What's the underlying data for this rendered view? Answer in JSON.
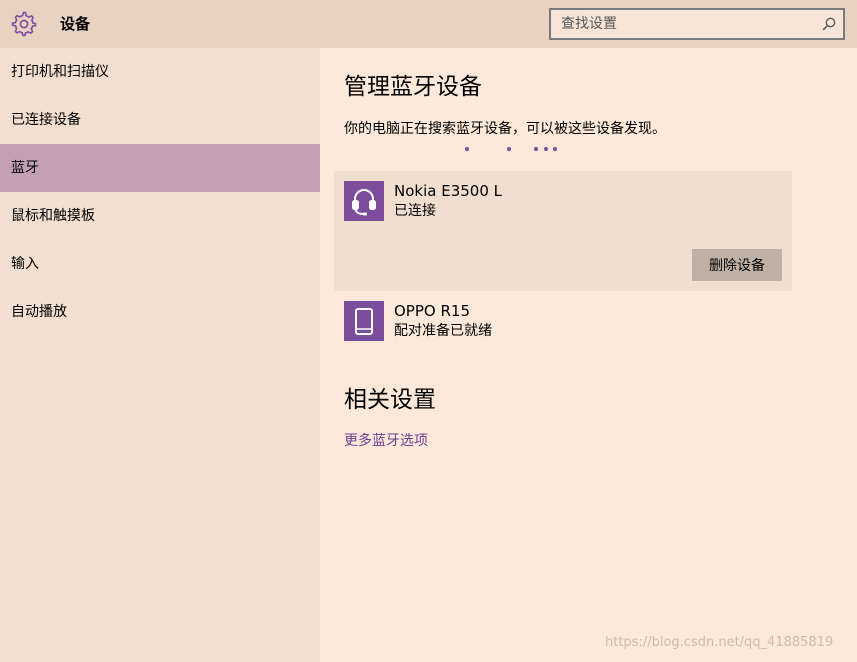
{
  "header": {
    "title": "设备",
    "search_placeholder": "查找设置",
    "icon": "gear-icon"
  },
  "sidebar": {
    "items": [
      {
        "label": "打印机和扫描仪",
        "active": false
      },
      {
        "label": "已连接设备",
        "active": false
      },
      {
        "label": "蓝牙",
        "active": true
      },
      {
        "label": "鼠标和触摸板",
        "active": false
      },
      {
        "label": "输入",
        "active": false
      },
      {
        "label": "自动播放",
        "active": false
      }
    ]
  },
  "main": {
    "heading": "管理蓝牙设备",
    "description": "你的电脑正在搜索蓝牙设备，可以被这些设备发现。",
    "devices": [
      {
        "name": "Nokia E3500 L",
        "status": "已连接",
        "icon": "headset-icon",
        "action_label": "删除设备"
      },
      {
        "name": "OPPO R15",
        "status": "配对准备已就绪",
        "icon": "phone-icon"
      }
    ],
    "related_heading": "相关设置",
    "related_link": "更多蓝牙选项"
  },
  "watermark": "https://blog.csdn.net/qq_41885819",
  "colors": {
    "accent": "#7b4d9c",
    "active_nav": "#c2a0b8",
    "link": "#6d3e94",
    "background": "#fde9d9",
    "sidebar": "#f2dfd0",
    "header": "#e8d2c2"
  }
}
